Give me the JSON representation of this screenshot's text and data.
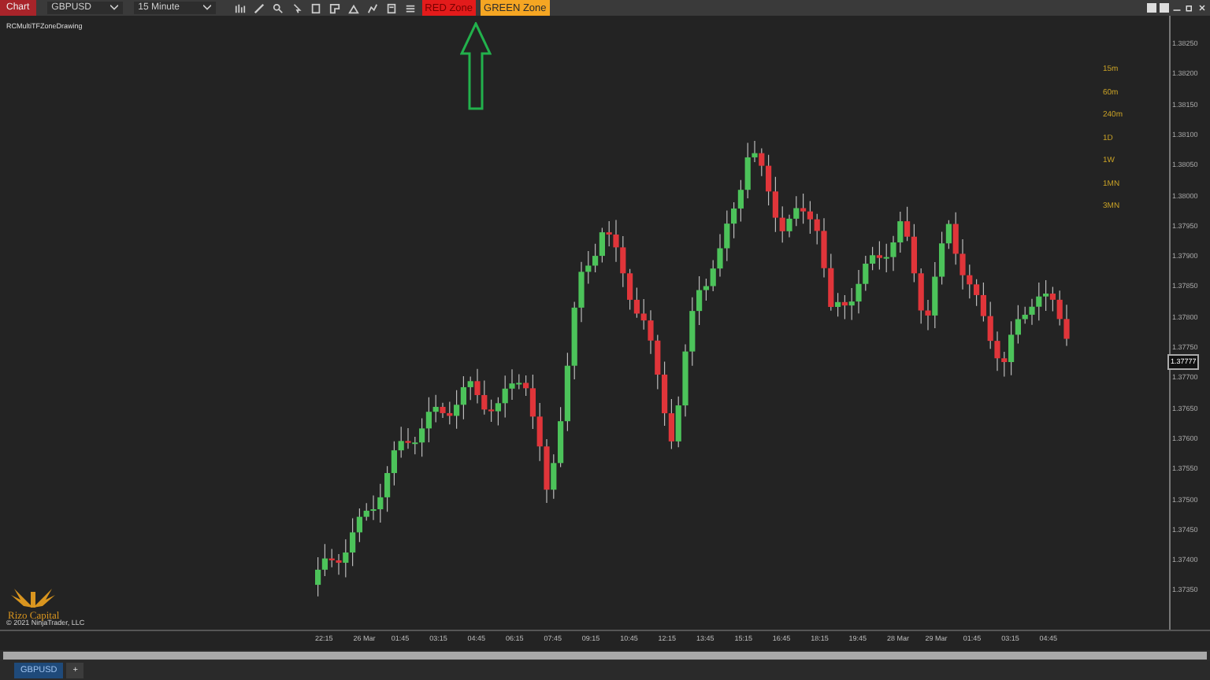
{
  "toolbar": {
    "title": "Chart",
    "instrument": "GBPUSD",
    "interval": "15 Minute",
    "zone_buttons": [
      {
        "label": "RED Zone",
        "kind": "red"
      },
      {
        "label": "GREEN Zone",
        "kind": "green"
      }
    ]
  },
  "chart": {
    "indicator_name": "RCMultiTFZoneDrawing",
    "timeframes": [
      "15m",
      "60m",
      "240m",
      "1D",
      "1W",
      "1MN",
      "3MN"
    ],
    "price_labels": [
      "1.38250",
      "1.38200",
      "1.38150",
      "1.38100",
      "1.38050",
      "1.38000",
      "1.37950",
      "1.37900",
      "1.37850",
      "1.37800",
      "1.37750",
      "1.37700",
      "1.37650",
      "1.37600",
      "1.37550",
      "1.37500",
      "1.37450",
      "1.37400",
      "1.37350"
    ],
    "current_price": "1.37777",
    "time_labels": [
      "22:15",
      "26 Mar",
      "01:45",
      "03:15",
      "04:45",
      "06:15",
      "07:45",
      "09:15",
      "10:45",
      "12:15",
      "13:45",
      "15:15",
      "16:45",
      "18:15",
      "19:45",
      "28 Mar",
      "29 Mar",
      "01:45",
      "03:15",
      "04:45"
    ],
    "logo_text": "Rizo Capital",
    "copyright": "© 2021 NinjaTrader, LLC"
  },
  "tabs": [
    {
      "label": "GBPUSD",
      "selected": true
    },
    {
      "label": "+",
      "selected": false
    }
  ]
}
